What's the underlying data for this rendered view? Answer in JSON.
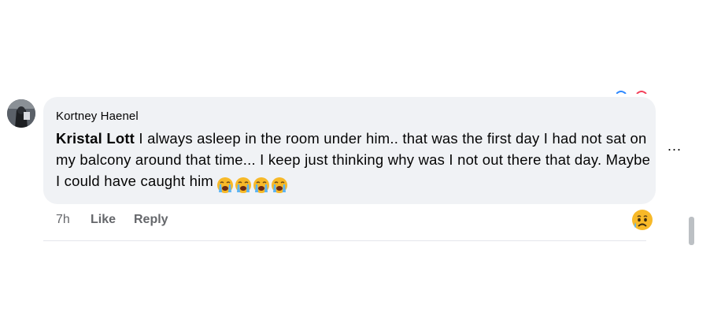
{
  "comment": {
    "author": "Kortney Haenel",
    "mention": "Kristal Lott",
    "body": " I always asleep in the room under him.. that was the first day I had not sat on my balcony around that time... I keep just thinking why was I not out there that day. Maybe I could have caught him",
    "emoji_count": 4,
    "emoji_icon": "loudly-crying-face-icon"
  },
  "actions": {
    "time": "7h",
    "like_label": "Like",
    "reply_label": "Reply"
  },
  "more_label": "...",
  "colors": {
    "bubble": "#f0f2f5",
    "meta_text": "#65676b",
    "emoji_yellow": "#f7b928"
  }
}
